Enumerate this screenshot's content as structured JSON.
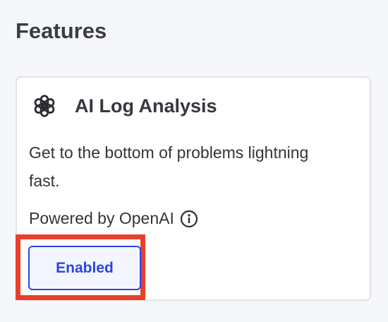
{
  "section": {
    "title": "Features"
  },
  "feature": {
    "icon": "openai-logo-icon",
    "title": "AI Log Analysis",
    "description": "Get to the bottom of problems lightning fast.",
    "powered_by": "Powered by OpenAI",
    "info_icon": "info-icon",
    "button_label": "Enabled"
  },
  "colors": {
    "accent": "#2a44e8",
    "highlight": "#e8402a"
  }
}
